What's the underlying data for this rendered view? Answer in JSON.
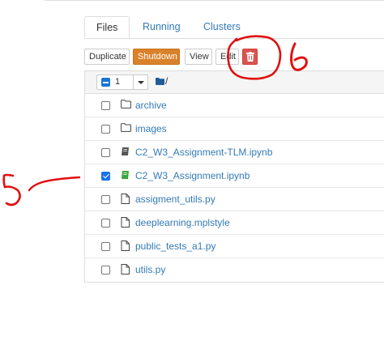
{
  "tabs": [
    {
      "label": "Files",
      "active": true
    },
    {
      "label": "Running",
      "active": false
    },
    {
      "label": "Clusters",
      "active": false
    }
  ],
  "toolbar": {
    "duplicate_label": "Duplicate",
    "shutdown_label": "Shutdown",
    "view_label": "View",
    "edit_label": "Edit",
    "delete_icon": "trash-icon"
  },
  "list_header": {
    "selected_count": "1",
    "path": "/"
  },
  "files": [
    {
      "name": "archive",
      "type": "folder",
      "checked": false
    },
    {
      "name": "images",
      "type": "folder",
      "checked": false
    },
    {
      "name": "C2_W3_Assignment-TLM.ipynb",
      "type": "notebook",
      "running": false,
      "checked": false
    },
    {
      "name": "C2_W3_Assignment.ipynb",
      "type": "notebook",
      "running": true,
      "checked": true
    },
    {
      "name": "assigment_utils.py",
      "type": "file",
      "checked": false
    },
    {
      "name": "deeplearning.mplstyle",
      "type": "file",
      "checked": false
    },
    {
      "name": "public_tests_a1.py",
      "type": "file",
      "checked": false
    },
    {
      "name": "utils.py",
      "type": "file",
      "checked": false
    }
  ],
  "annotations": {
    "label_5": "5",
    "label_6": "6",
    "color": "#e01010"
  },
  "colors": {
    "link": "#337ab7",
    "shutdown": "#d9822b",
    "delete": "#d9534f",
    "checkbox_checked": "#1a73e8",
    "running_notebook": "#3aa53a"
  }
}
